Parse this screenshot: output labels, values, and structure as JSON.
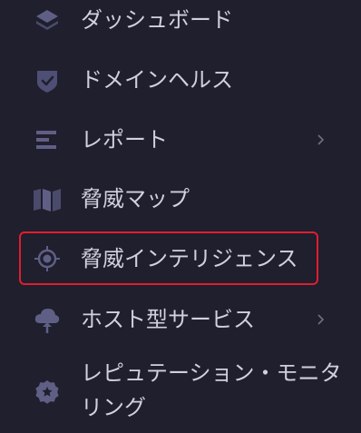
{
  "menu": {
    "items": [
      {
        "id": "dashboard",
        "label": "ダッシュボード",
        "icon": "layers-icon",
        "has_submenu": false,
        "selected": false
      },
      {
        "id": "domain-health",
        "label": "ドメインヘルス",
        "icon": "shield-check-icon",
        "has_submenu": false,
        "selected": false
      },
      {
        "id": "report",
        "label": "レポート",
        "icon": "report-lines-icon",
        "has_submenu": true,
        "selected": false
      },
      {
        "id": "threat-map",
        "label": "脅威マップ",
        "icon": "map-icon",
        "has_submenu": false,
        "selected": false
      },
      {
        "id": "threat-intelligence",
        "label": "脅威インテリジェンス",
        "icon": "crosshair-icon",
        "has_submenu": false,
        "selected": true
      },
      {
        "id": "hosting-services",
        "label": "ホスト型サービス",
        "icon": "cloud-upload-icon",
        "has_submenu": true,
        "selected": false
      },
      {
        "id": "reputation-monitoring",
        "label": "レピュテーション・モニタリング",
        "icon": "badge-star-icon",
        "has_submenu": false,
        "selected": false
      }
    ]
  },
  "colors": {
    "background": "#1f1f2e",
    "text": "#d0d1df",
    "icon": "#5f5f86",
    "chevron": "#6f6f85",
    "selection_border": "#e11d2e"
  }
}
